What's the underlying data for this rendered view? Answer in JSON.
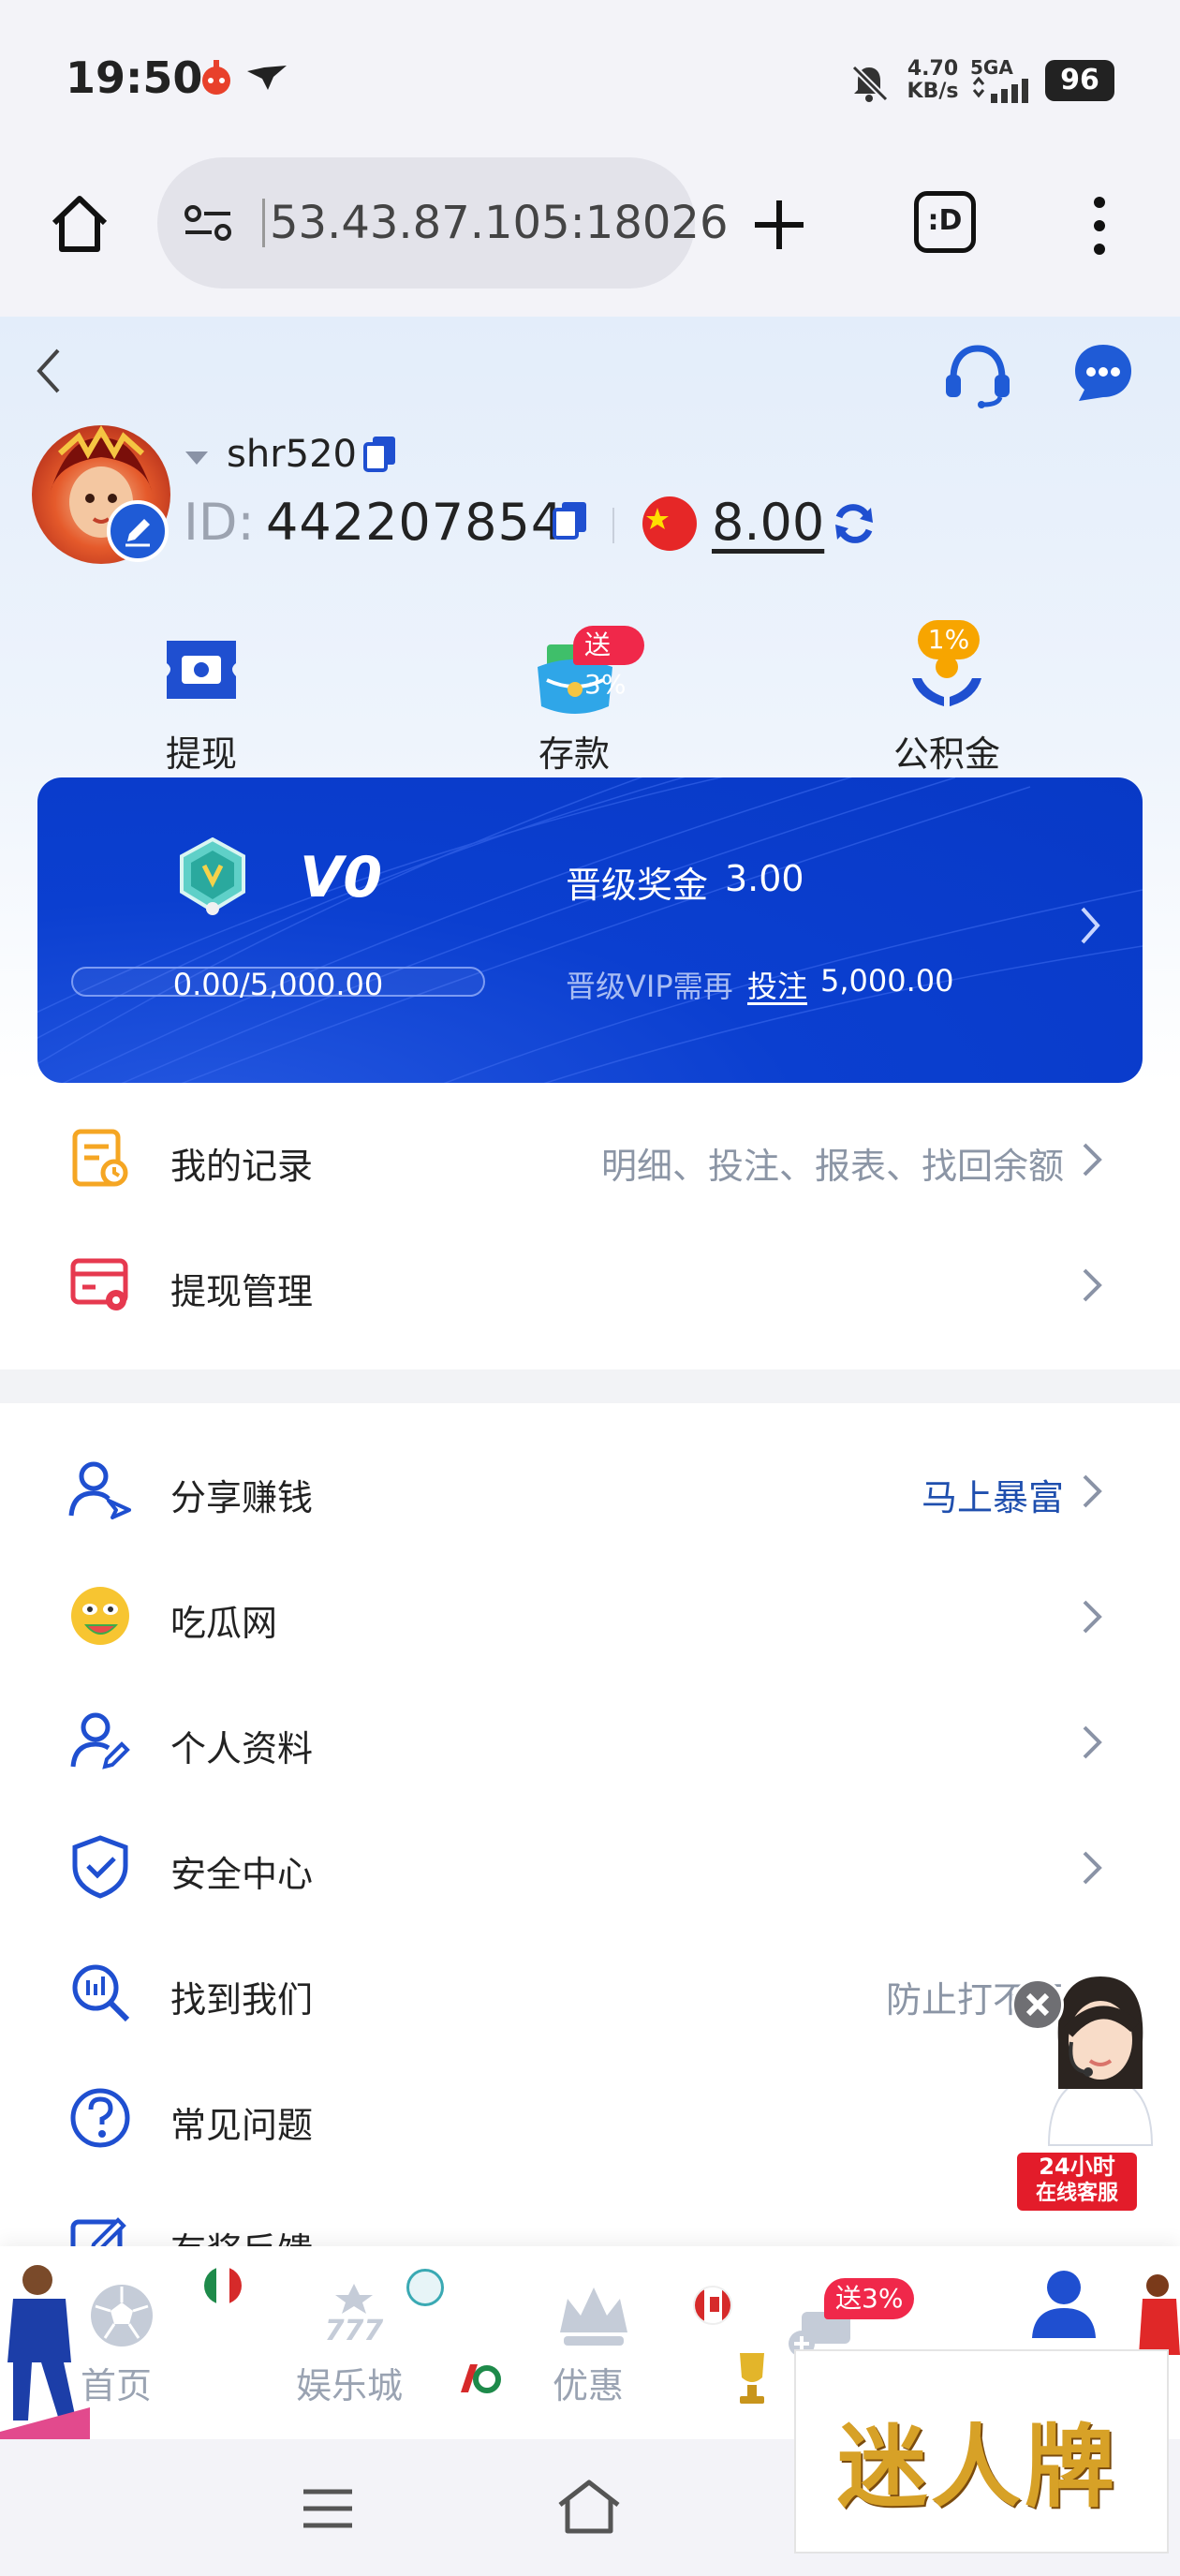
{
  "status": {
    "time": "19:50",
    "net_speed_value": "4.70",
    "net_speed_unit": "KB/s",
    "network": "5GA",
    "battery": "96"
  },
  "browser": {
    "url": "53.43.87.105:18026",
    "tabs_label": ":D"
  },
  "profile": {
    "username": "shr520",
    "id_label": "ID:",
    "id_value": "442207854",
    "balance": "8.00"
  },
  "quick_actions": [
    {
      "label": "提现",
      "icon": "withdraw-icon"
    },
    {
      "label": "存款",
      "badge": "送3%",
      "icon": "deposit-wallet-icon"
    },
    {
      "label": "公积金",
      "badge": "1%",
      "icon": "fund-hands-icon"
    }
  ],
  "vip": {
    "level": "V0",
    "progress_text": "0.00/5,000.00",
    "progress": 0.0,
    "bonus_label": "晋级奖金",
    "bonus_value": "3.00",
    "need_label": "晋级VIP需再",
    "need_action": "投注",
    "need_value": "5,000.00"
  },
  "menu_group1": [
    {
      "label": "我的记录",
      "hint": "明细、投注、报表、找回余额",
      "icon": "record-icon"
    },
    {
      "label": "提现管理",
      "hint": "",
      "icon": "card-settings-icon"
    }
  ],
  "menu_group2": [
    {
      "label": "分享赚钱",
      "hint": "马上暴富",
      "icon": "share-user-icon"
    },
    {
      "label": "吃瓜网",
      "hint": "",
      "icon": "melon-face-icon"
    },
    {
      "label": "个人资料",
      "hint": "",
      "icon": "user-edit-icon"
    },
    {
      "label": "安全中心",
      "hint": "",
      "icon": "shield-check-icon"
    },
    {
      "label": "找到我们",
      "hint": "防止打不开",
      "icon": "search-doc-icon"
    },
    {
      "label": "常见问题",
      "hint": "",
      "icon": "question-icon"
    },
    {
      "label": "有奖反馈",
      "hint": "",
      "icon": "feedback-edit-icon"
    }
  ],
  "support_widget": {
    "line1": "24小时",
    "line2": "在线客服"
  },
  "tabbar": [
    {
      "label": "首页",
      "icon": "football-icon"
    },
    {
      "label": "娱乐城",
      "icon": "slot-777-icon"
    },
    {
      "label": "优惠",
      "icon": "crown-icon"
    },
    {
      "label": "",
      "badge": "送3%",
      "icon": "gift-cart-icon"
    },
    {
      "label": "",
      "icon": "profile-icon"
    }
  ],
  "ad": {
    "text": "迷人牌"
  },
  "colors": {
    "primary": "#0b3fd0",
    "accent_red": "#f0284a",
    "hint_blue": "#1f4fae"
  }
}
